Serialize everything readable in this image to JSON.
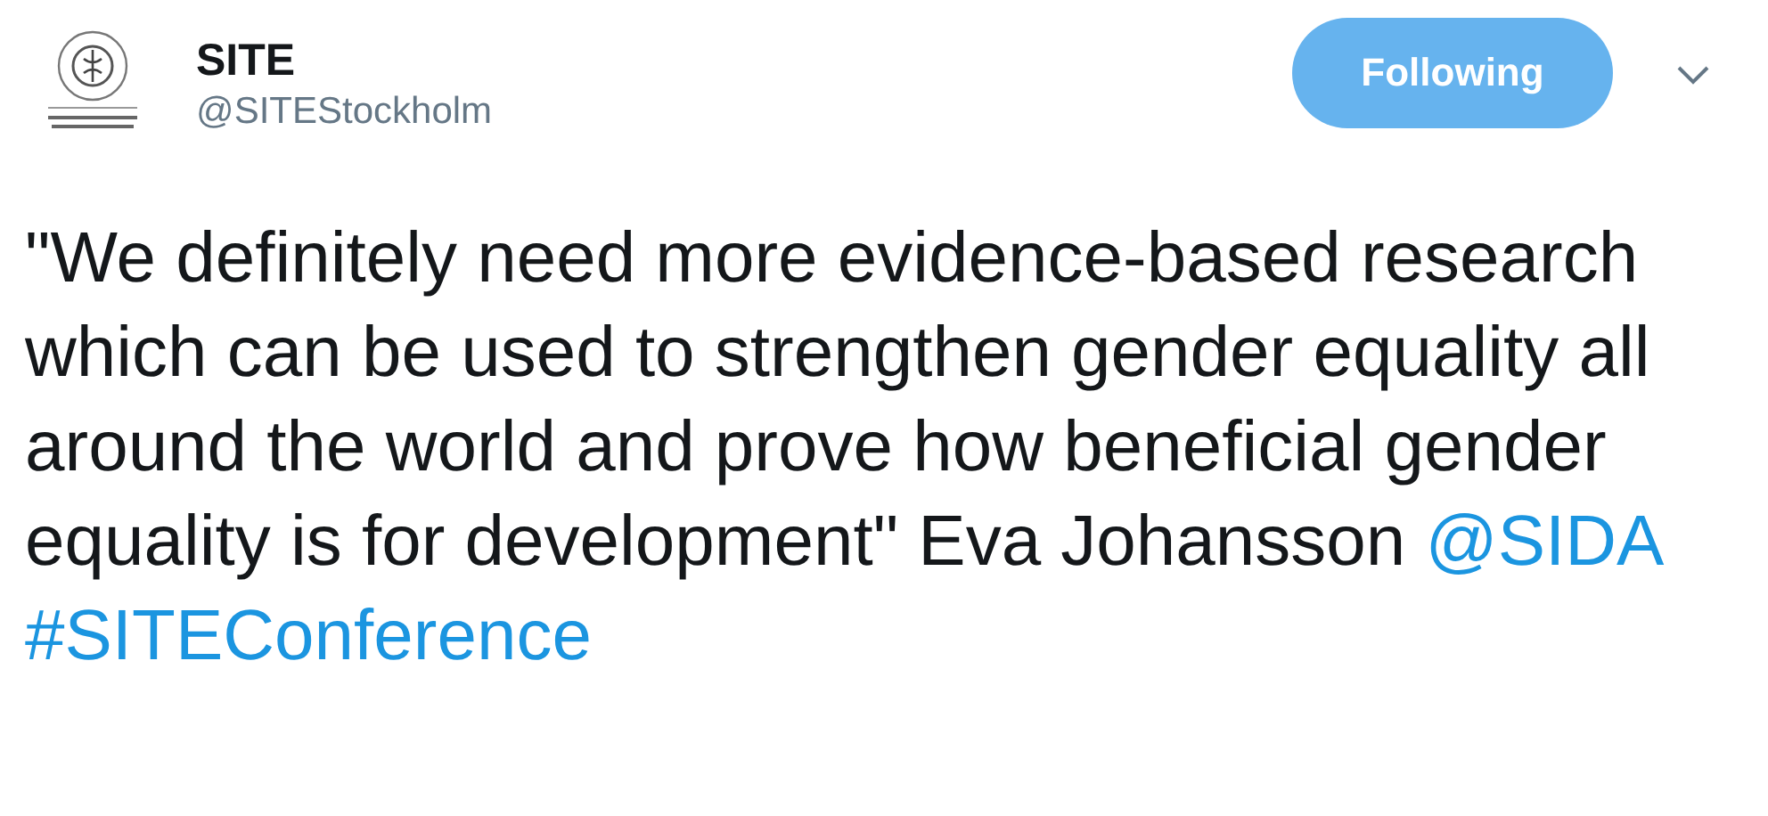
{
  "account": {
    "name": "SITE",
    "handle": "@SITEStockholm"
  },
  "follow_button": {
    "label": "Following",
    "selected": true
  },
  "tweet": {
    "text": "\"We definitely need more evidence-based research which can be used to strengthen gender equality all around the world and prove how beneficial gender equality is for development\" Eva Johansson",
    "mention": "@SIDA",
    "hashtag": "#SITEConference"
  }
}
